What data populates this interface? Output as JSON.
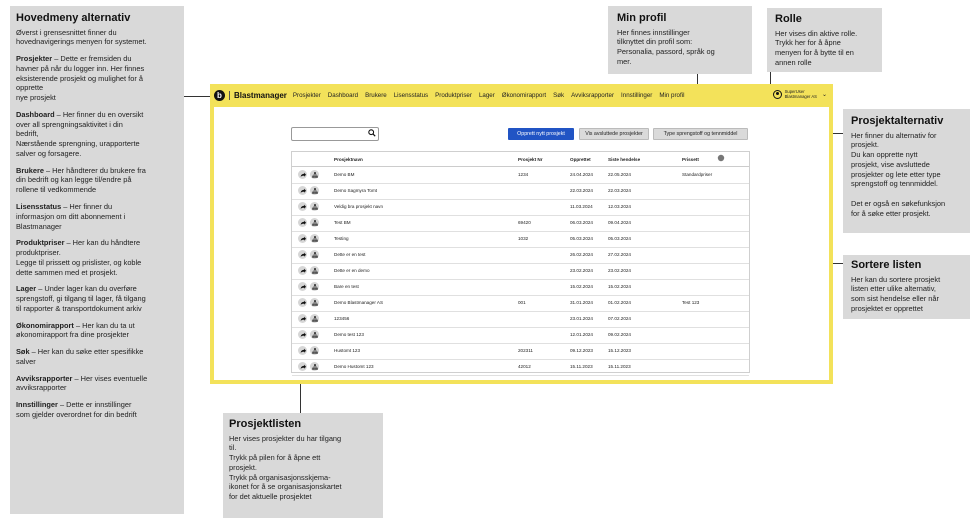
{
  "left_panel": {
    "title": "Hovedmeny alternativ",
    "intro": "Øverst i grensesnittet finner du\nhovednavigerings  menyen for systemet.",
    "items": [
      {
        "name": "Prosjekter",
        "text": " –  Dette er fremsiden du\nhavner på når du logger inn. Her finnes\neksisterende prosjekt og mulighet for å\nopprette\nnye prosjekt"
      },
      {
        "name": "Dashboard",
        "text": " –  Her finner du en oversikt\nover all sprengningsaktivitet  i din\nbedrift,\nNærstående sprengning,  urapporterte\nsalver og forsagere."
      },
      {
        "name": "Brukere",
        "text": " – Her håndterer du brukere fra\ndin bedrift og kan legge til/endre på\nrollene til vedkommende"
      },
      {
        "name": "Lisensstatus",
        "text": " – Her finner du\ninformasjon om ditt abonnement i\nBlastmanager"
      },
      {
        "name": "Produktpriser",
        "text": " –  Her kan du håndtere\nproduktpriser.\nLegge til prissett og prislister,  og koble\ndette sammen med et prosjekt."
      },
      {
        "name": "Lager",
        "text": " –  Under lager kan du overføre\nsprengstoff, gi tilgang til lager, få tilgang\ntil rapporter & transportdokument  arkiv"
      },
      {
        "name": "Økonomirapport",
        "text": " –  Her kan du ta ut\nøkonomirapport fra dine prosjekter"
      },
      {
        "name": "Søk",
        "text": " – Her kan du søke etter spesifikke\nsalver"
      },
      {
        "name": "Avviksrapporter",
        "text": " –  Her vises eventuelle\navviksrapporter"
      },
      {
        "name": "Innstillinger",
        "text": " –  Dette er innstillinger\nsom gjelder overordnet for din bedrift"
      }
    ]
  },
  "callouts": {
    "min_profil": {
      "title": "Min profil",
      "text": "Her finnes innstillinger\ntilknyttet din profil som:\nPersonalia,  passord,  språk og\nmer."
    },
    "rolle": {
      "title": "Rolle",
      "text": "Her vises din aktive rolle.\nTrykk  her for å åpne\nmenyen for å bytte til en\nannen rolle"
    },
    "prosjektalternativ": {
      "title": "Prosjektalternativ",
      "text": "Her finner du alternativ for\nprosjekt.\nDu kan opprette nytt\nprosjekt,  vise avsluttede\nprosjekter  og lete etter type\nsprengstoff  og tennmiddel.\n\nDet er også  en søkefunksjon\nfor å søke etter prosjekt."
    },
    "sortere": {
      "title": "Sortere listen",
      "text": "Her kan du sortere prosjekt\nlisten etter ulike alternativ,\nsom sist hendelse  eller når\nprosjektet er opprettet"
    },
    "prosjektlisten": {
      "title": "Prosjektlisten",
      "text": "Her vises prosjekter du har tilgang\ntil.\nTrykk  på pilen for å åpne ett\nprosjekt.\nTrykk  på organisasjonsskjema-\nikonet for å se organisasjonskartet\nfor det aktuelle prosjektet"
    }
  },
  "app": {
    "logo_letter": "b",
    "brand": "Blastmanager",
    "nav": [
      "Prosjekter",
      "Dashboard",
      "Brukere",
      "Lisensstatus",
      "Produktpriser",
      "Lager",
      "Økonomirapport",
      "Søk",
      "Avviksrapporter",
      "Innstillinger",
      "Min profil"
    ],
    "user_role": "SuperUser",
    "user_company": "Blastmanager AS",
    "chevron": "⌄",
    "search_placeholder": "",
    "buttons": {
      "new": "Opprett nytt prosjekt",
      "closed": "Vis avsluttede prosjekter",
      "type": "Type sprengstoff og tennmiddel"
    },
    "accent": "#f3e25a",
    "primary": "#2154c4",
    "table": {
      "headers": [
        "Prosjektnavn",
        "Prosjekt Nr",
        "Opprettet",
        "Siste hendelse",
        "Prissett"
      ],
      "rows": [
        [
          "Demo BM",
          "1234",
          "24.04.2024",
          "22.05.2024",
          "Standardpriser"
        ],
        [
          "Demo Sagmyra Tomt",
          "",
          "22.03.2024",
          "22.03.2024",
          ""
        ],
        [
          "Veldig bra prosjekt navn",
          "",
          "11.03.2024",
          "12.03.2024",
          ""
        ],
        [
          "Test BM",
          "69420",
          "06.03.2024",
          "09.04.2024",
          ""
        ],
        [
          "Testing",
          "1032",
          "05.03.2024",
          "05.03.2024",
          ""
        ],
        [
          "Dette er en test",
          "",
          "26.02.2024",
          "27.02.2024",
          ""
        ],
        [
          "Dette er en demo",
          "",
          "23.02.2024",
          "23.02.2024",
          ""
        ],
        [
          "Bare en test",
          "",
          "15.02.2024",
          "15.02.2024",
          ""
        ],
        [
          "Demo Blastmanager AS",
          "001",
          "31.01.2024",
          "01.02.2024",
          "Test 123"
        ],
        [
          "123456",
          "",
          "23.01.2024",
          "07.02.2024",
          ""
        ],
        [
          "Demo test 123",
          "",
          "12.01.2024",
          "09.02.2024",
          ""
        ],
        [
          "Hustomt 123",
          "202311",
          "09.12.2023",
          "15.12.2023",
          ""
        ],
        [
          "Demo Hustomt 123",
          "42012",
          "15.11.2023",
          "15.11.2023",
          ""
        ]
      ]
    }
  }
}
